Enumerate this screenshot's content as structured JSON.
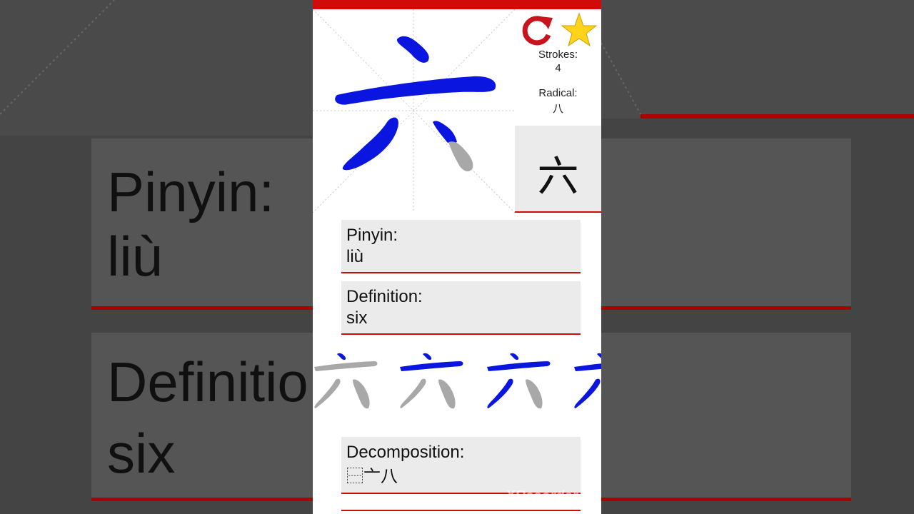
{
  "app": {
    "character": "六",
    "strokes_label": "Strokes:",
    "strokes_value": "4",
    "radical_label": "Radical:",
    "radical_value": "八",
    "pinyin_label": "Pinyin:",
    "pinyin_value": "liù",
    "definition_label": "Definition:",
    "definition_value": "six",
    "decomposition_label": "Decomposition:",
    "decomposition_value": "⿱亠八",
    "icons": {
      "replay": "replay-icon",
      "favorite": "star-icon"
    }
  },
  "background": {
    "pinyin_label": "Pinyin:",
    "pinyin_value": "liù",
    "definition_label": "Definitio",
    "definition_value": "six"
  },
  "watermark": "XRecorder",
  "colors": {
    "accent": "#d10a0a",
    "stroke_done": "#0a16e0",
    "stroke_pending": "#a8a8a8",
    "card_bg": "#ebebeb"
  }
}
